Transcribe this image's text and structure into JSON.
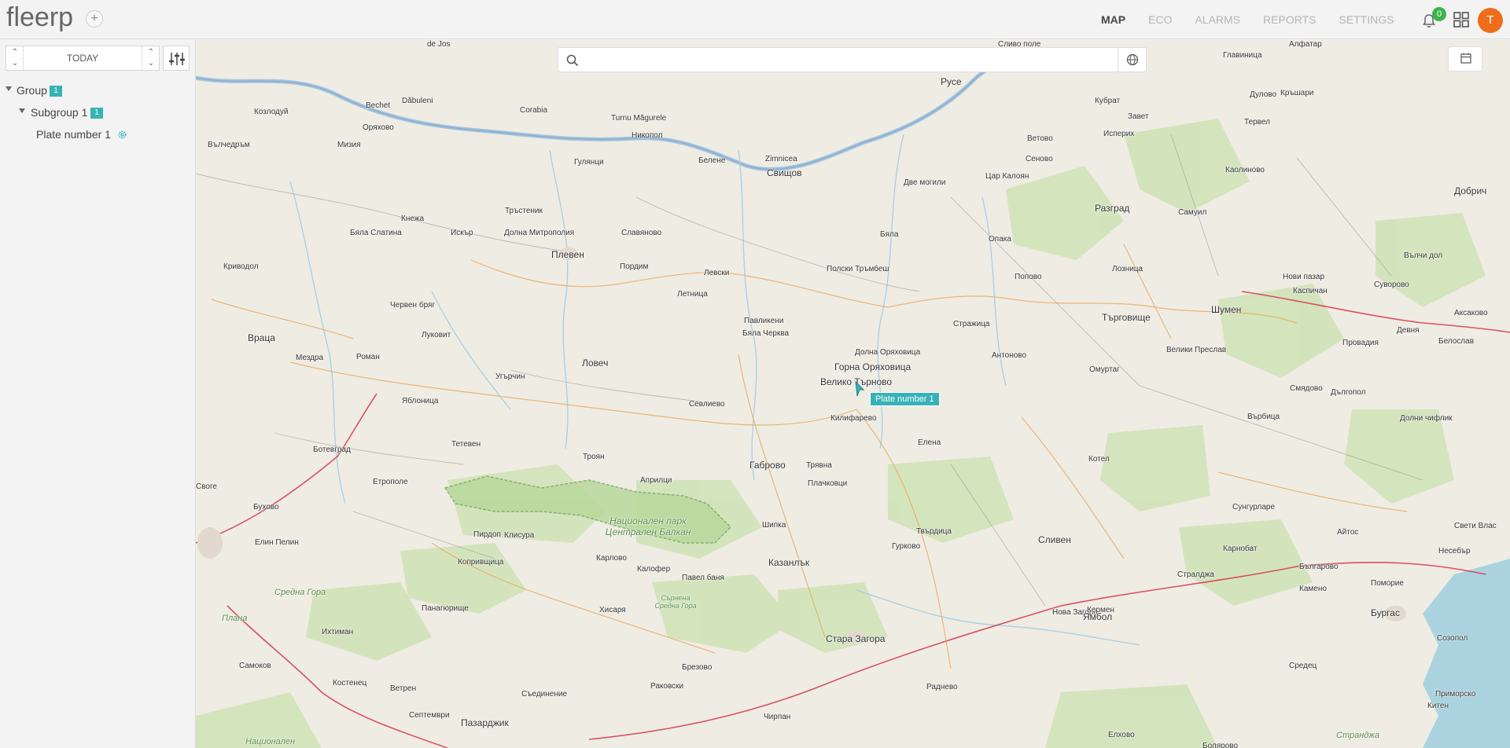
{
  "app": {
    "logo": "fleerp",
    "add_symbol": "+"
  },
  "nav": {
    "items": [
      {
        "label": "MAP",
        "active": true
      },
      {
        "label": "ECO",
        "active": false
      },
      {
        "label": "ALARMS",
        "active": false
      },
      {
        "label": "REPORTS",
        "active": false
      },
      {
        "label": "SETTINGS",
        "active": false
      }
    ],
    "notification_count": "0",
    "avatar_initial": "T"
  },
  "sidebar": {
    "date_label": "TODAY",
    "tree": {
      "group": {
        "label": "Group",
        "count": "1"
      },
      "subgroup": {
        "label": "Subgroup 1",
        "count": "1"
      },
      "vehicle": {
        "label": "Plate number 1"
      }
    }
  },
  "map": {
    "search_placeholder": "",
    "vehicle_label": "Plate number 1",
    "places": [
      "de Jos",
      "Сливо поле",
      "Алфатар",
      "Главиница",
      "Bechet",
      "Dăbuleni",
      "Corabia",
      "Turnu Măgurele",
      "Русе",
      "Кубрат",
      "Завет",
      "Дулово",
      "Кръшари",
      "Козлодуй",
      "Оряхово",
      "Никопол",
      "Ветово",
      "Исперих",
      "Тервел",
      "Вълчедръм",
      "Мизия",
      "Гулянци",
      "Белене",
      "Zimnicea",
      "Свищов",
      "Две могили",
      "Сеново",
      "Цар Калоян",
      "Каолиново",
      "Добрич",
      "Тръстеник",
      "Кнежа",
      "Искър",
      "Долна Митрополия",
      "Славяново",
      "Бяла",
      "Разград",
      "Самуил",
      "Бяла Слатина",
      "Плевен",
      "Опака",
      "Вълчи дол",
      "Криводол",
      "Пордим",
      "Левски",
      "Полски Тръмбеш",
      "Попово",
      "Лозница",
      "Нови пазар",
      "Каспичан",
      "Суворово",
      "Червен бряг",
      "Летница",
      "Стражица",
      "Търговище",
      "Шумен",
      "Аксаково",
      "Враца",
      "Луковит",
      "Павликени",
      "Бяла Черква",
      "Долна Оряховица",
      "Антоново",
      "Велики Преслав",
      "Провадия",
      "Девня",
      "Белослав",
      "Мездра",
      "Роман",
      "Ловеч",
      "Горна Оряховица",
      "Омуртаг",
      "Угърчин",
      "Велико Търново",
      "Смядово",
      "Дългопол",
      "Яблоница",
      "Севлиево",
      "Килифарево",
      "Върбица",
      "Долни чифлик",
      "Тетевен",
      "Елена",
      "Ботевград",
      "Троян",
      "Габрово",
      "Трявна",
      "Котел",
      "Етрополе",
      "Априлци",
      "Плачковци",
      "Своге",
      "Бухово",
      "Шипка",
      "Твърдица",
      "Сунгурларе",
      "Айтос",
      "Свети Влас",
      "Елин Пелин",
      "Пирдоп",
      "Клисура",
      "Казанлък",
      "Гурково",
      "Сливен",
      "Карнобат",
      "Несебър",
      "Копривщица",
      "Карлово",
      "Калофер",
      "Павел баня",
      "Стралджа",
      "Българово",
      "Поморие",
      "Бургас",
      "Камено",
      "Средна Гора",
      "Панагюрище",
      "Хисаря",
      "Нова Загора",
      "Кермен",
      "Ихтиман",
      "Стара Загора",
      "Ямбол",
      "Созопол",
      "Самоков",
      "Костенец",
      "Брезово",
      "Раднево",
      "Средец",
      "Ветрен",
      "Раковски",
      "Съединение",
      "Приморско",
      "Септември",
      "Пазарджик",
      "Чирпан",
      "Китен",
      "Национален",
      "Елхово",
      "Болярово",
      "Странджа",
      "Национален парк Централен Балкан",
      "Сърнена Средна Гора",
      "Плана"
    ]
  },
  "colors": {
    "accent": "#36b3b7",
    "badge_green": "#3cb44b",
    "avatar": "#ee6c1a",
    "water": "#aad3df",
    "forest": "#c8dfb0"
  }
}
